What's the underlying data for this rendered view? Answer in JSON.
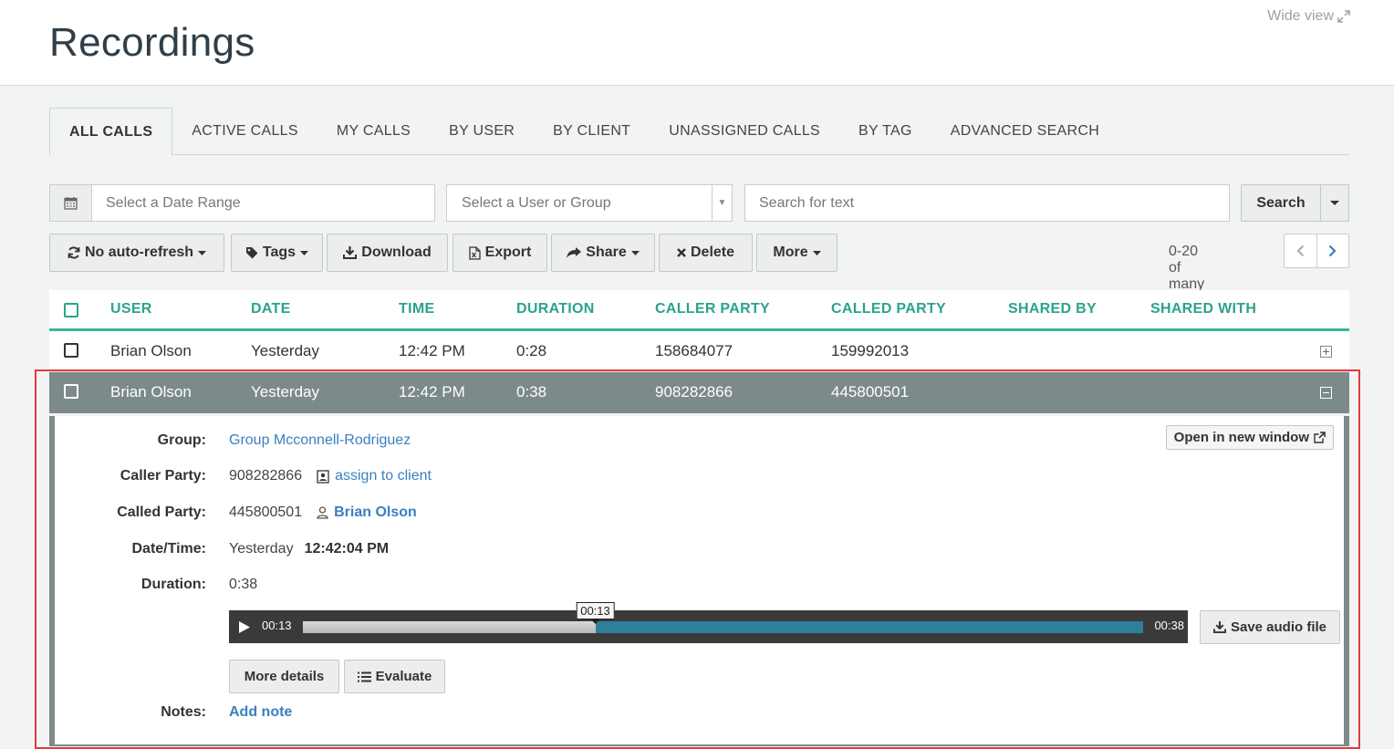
{
  "header": {
    "title": "Recordings",
    "wide_view": "Wide view",
    "wide_view_icon": "expand-icon"
  },
  "tabs": [
    {
      "label": "ALL CALLS",
      "active": true
    },
    {
      "label": "ACTIVE CALLS"
    },
    {
      "label": "MY CALLS"
    },
    {
      "label": "BY USER"
    },
    {
      "label": "BY CLIENT"
    },
    {
      "label": "UNASSIGNED CALLS"
    },
    {
      "label": "BY TAG"
    },
    {
      "label": "ADVANCED SEARCH"
    }
  ],
  "filters": {
    "date_placeholder": "Select a Date Range",
    "user_placeholder": "Select a User or Group",
    "text_placeholder": "Search for text",
    "search_label": "Search"
  },
  "actions": {
    "refresh": "No auto-refresh",
    "tags": "Tags",
    "download": "Download",
    "export": "Export",
    "share": "Share",
    "delete": "Delete",
    "more": "More",
    "pager_text": "0-20 of many"
  },
  "table": {
    "columns": [
      "USER",
      "DATE",
      "TIME",
      "DURATION",
      "CALLER PARTY",
      "CALLED PARTY",
      "SHARED BY",
      "SHARED WITH"
    ],
    "rows": [
      {
        "user": "Brian Olson",
        "date": "Yesterday",
        "time": "12:42 PM",
        "duration": "0:28",
        "caller": "158684077",
        "called": "159992013",
        "expanded": false
      },
      {
        "user": "Brian Olson",
        "date": "Yesterday",
        "time": "12:42 PM",
        "duration": "0:38",
        "caller": "908282866",
        "called": "445800501",
        "expanded": true
      }
    ]
  },
  "detail": {
    "group_label": "Group:",
    "group_value": "Group Mcconnell-Rodriguez",
    "caller_label": "Caller Party:",
    "caller_value": "908282866",
    "assign_link": "assign to client",
    "called_label": "Called Party:",
    "called_value": "445800501",
    "called_user": "Brian Olson",
    "datetime_label": "Date/Time:",
    "date_value": "Yesterday",
    "time_value": "12:42:04 PM",
    "duration_label": "Duration:",
    "duration_value": "0:38",
    "open_window": "Open in new window",
    "player": {
      "current": "00:13",
      "total": "00:38",
      "tooltip": "00:13",
      "progress": 0.348
    },
    "save_audio": "Save audio file",
    "more_details": "More details",
    "evaluate": "Evaluate",
    "notes_label": "Notes:",
    "add_note": "Add note"
  },
  "colors": {
    "accent": "#2ca389",
    "link": "#3a7fc1",
    "selected_row": "#7d8a8a",
    "highlight": "#e5393d"
  }
}
